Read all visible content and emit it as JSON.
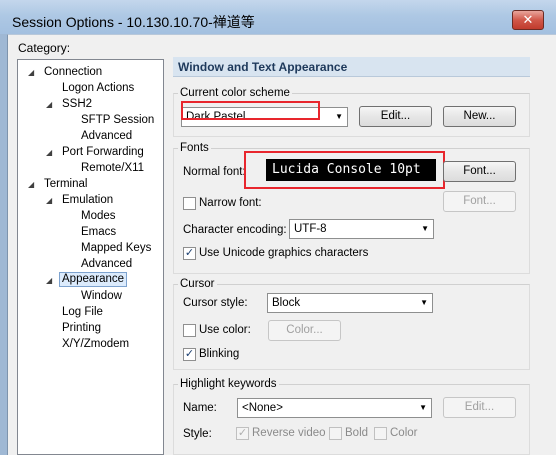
{
  "window": {
    "title": "Session Options - 10.130.10.70-禅道等",
    "close_glyph": "✕"
  },
  "category": {
    "label": "Category:",
    "tree": {
      "connection": "Connection",
      "logon_actions": "Logon Actions",
      "ssh2": "SSH2",
      "sftp_session": "SFTP Session",
      "ssh2_advanced": "Advanced",
      "port_forwarding": "Port Forwarding",
      "remote_x11": "Remote/X11",
      "terminal": "Terminal",
      "emulation": "Emulation",
      "modes": "Modes",
      "emacs": "Emacs",
      "mapped_keys": "Mapped Keys",
      "emulation_advanced": "Advanced",
      "appearance": "Appearance",
      "window": "Window",
      "log_file": "Log File",
      "printing": "Printing",
      "xyzmodem": "X/Y/Zmodem"
    },
    "expanded_arrow": "◢",
    "collapsed_arrow": "▷"
  },
  "panel": {
    "header": "Window and Text Appearance",
    "color_scheme": {
      "title": "Current color scheme",
      "value": "Dark Pastel",
      "edit_button": "Edit...",
      "new_button": "New..."
    },
    "fonts": {
      "title": "Fonts",
      "normal_font_label": "Normal font:",
      "normal_font_preview": "Lucida Console 10pt",
      "font_button": "Font...",
      "narrow_font_label": "Narrow font:",
      "narrow_font_button": "Font...",
      "encoding_label": "Character encoding:",
      "encoding_value": "UTF-8",
      "unicode_graphics_label": "Use Unicode graphics characters"
    },
    "cursor": {
      "title": "Cursor",
      "style_label": "Cursor style:",
      "style_value": "Block",
      "use_color_label": "Use color:",
      "color_button": "Color...",
      "blinking_label": "Blinking"
    },
    "highlight": {
      "title": "Highlight keywords",
      "name_label": "Name:",
      "name_value": "<None>",
      "edit_button": "Edit...",
      "style_label": "Style:",
      "reverse_video_label": "Reverse video",
      "bold_label": "Bold",
      "color_label": "Color"
    }
  },
  "checkmark": "✓",
  "dropdown_arrow": "▼"
}
